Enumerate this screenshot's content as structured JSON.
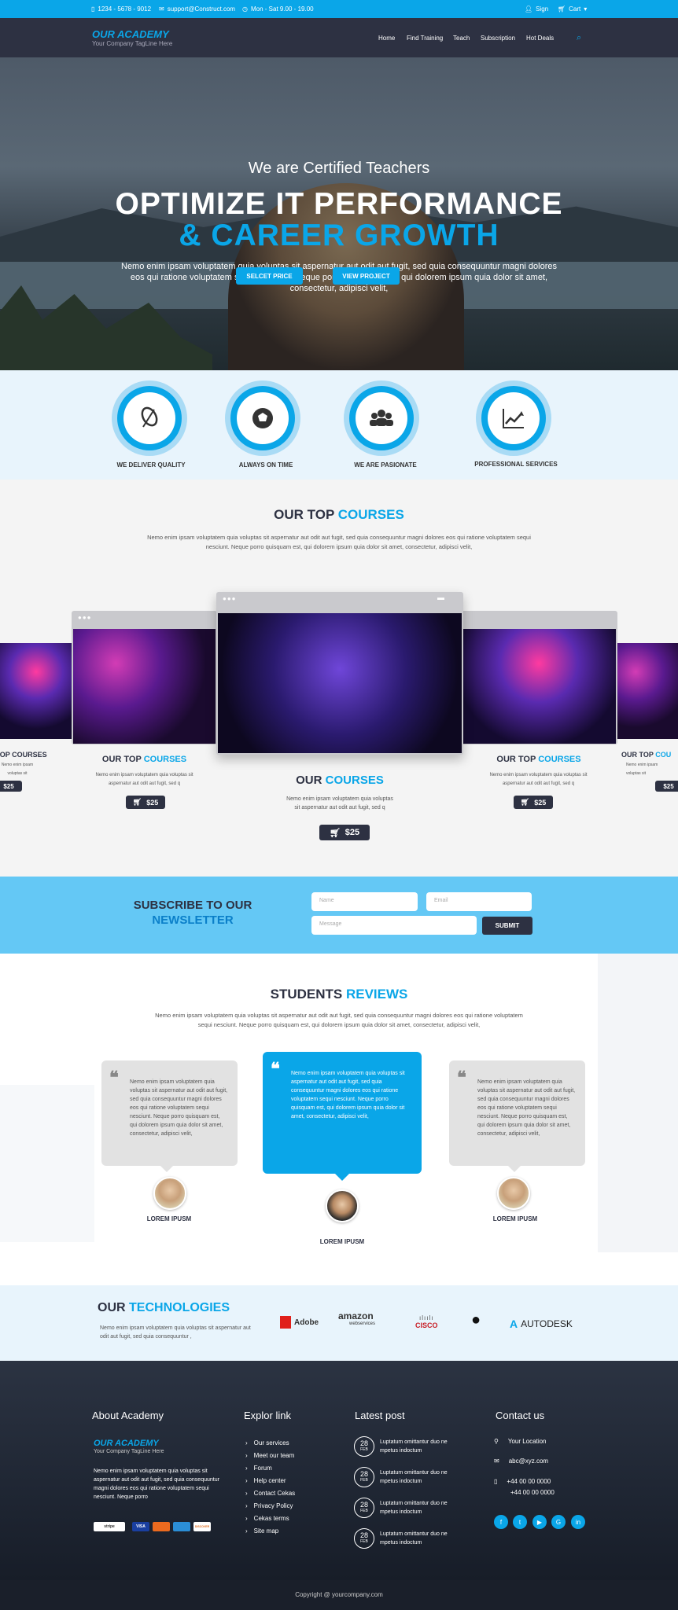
{
  "topbar": {
    "phone": "1234 - 5678 - 9012",
    "email": "support@Construct.com",
    "hours": "Mon - Sat 9.00 - 19.00",
    "sign": "Sign",
    "cart": "Cart"
  },
  "nav": {
    "logo": "OUR ACADEMY",
    "tagline": "Your Company TagLine Here",
    "items": [
      "Home",
      "Find Training",
      "Teach",
      "Subscription",
      "Hot Deals"
    ]
  },
  "hero": {
    "subtitle": "We are Certified Teachers",
    "title1": "OPTIMIZE IT PERFORMANCE",
    "title2": "& CAREER GROWTH",
    "text": "Nemo enim ipsam voluptatem quia voluptas sit aspernatur aut odit aut fugit, sed quia consequuntur magni dolores eos qui ratione voluptatem sequi nesciunt. Neque porro quisquam est, qui dolorem ipsum quia dolor sit amet, consectetur, adipisci velit,",
    "btn1": "SELCET PRICE",
    "btn2": "VIEW PROJECT"
  },
  "features": [
    {
      "label": "WE DELIVER QUALITY",
      "icon": "leaf-icon"
    },
    {
      "label": "ALWAYS ON TIME",
      "icon": "soccer-ball-icon"
    },
    {
      "label": "WE ARE PASIONATE",
      "icon": "group-icon"
    },
    {
      "label": "PROFESSIONAL SERVICES",
      "icon": "chart-icon"
    }
  ],
  "courses": {
    "title_a": "OUR TOP",
    "title_b": "COURSES",
    "text": "Nemo enim ipsam voluptatem quia voluptas sit aspernatur aut odit aut fugit, sed quia consequuntur magni dolores eos qui ratione voluptatem sequi nesciunt. Neque porro quisquam est, qui dolorem ipsum quia dolor sit amet, consectetur, adipisci velit,",
    "left_title_a": "OUR TOP",
    "left_title_b": "COURSES",
    "left_text": "Nemo enim ipsam voluptatem quia voluptas sit aspernatur aut odit aut fugit, sed q",
    "center_title_a": "OUR",
    "center_title_b": "COURSES",
    "center_text": "Nemo enim ipsam voluptatem quia voluptas sit aspernatur aut odit aut fugit, sed q",
    "right_title_a": "OUR TOP",
    "right_title_b": "COURSES",
    "right_text": "Nemo enim ipsam voluptatem quia voluptas sit aspernatur aut odit aut fugit, sed q",
    "edge_left_title": "TOP COURSES",
    "edge_right_title_a": "OUR TOP",
    "edge_right_title_b": "COU",
    "edge_text": "Nemo enim ipsam voluptas sit",
    "price": "$25",
    "edge_price": "$25"
  },
  "newsletter": {
    "title1": "SUBSCRIBE TO OUR",
    "title2": "NEWSLETTER",
    "name_ph": "Name",
    "email_ph": "Email",
    "message_ph": "Message",
    "submit": "SUBMIT"
  },
  "reviews": {
    "title_a": "STUDENTS",
    "title_b": "REVIEWS",
    "text": "Nemo enim ipsam voluptatem quia voluptas sit aspernatur aut odit aut fugit, sed quia consequuntur magni dolores eos qui ratione voluptatem sequi nesciunt. Neque porro quisquam est, qui dolorem ipsum quia dolor sit amet, consectetur, adipisci velit,",
    "items": [
      {
        "text": "Nemo enim ipsam voluptatem quia voluptas sit aspernatur aut odit aut fugit, sed quia consequuntur magni dolores eos qui ratione voluptatem sequi nesciunt. Neque porro quisquam est, qui dolorem ipsum quia dolor sit amet, consectetur, adipisci velit,",
        "name": "LOREM IPUSM"
      },
      {
        "text": "Nemo enim ipsam voluptatem quia voluptas sit aspernatur aut odit aut fugit, sed quia consequuntur magni dolores eos qui ratione voluptatem sequi nesciunt. Neque porro quisquam est, qui dolorem ipsum quia dolor sit amet, consectetur, adipisci velit,",
        "name": "LOREM IPUSM"
      },
      {
        "text": "Nemo enim ipsam voluptatem quia voluptas sit aspernatur aut odit aut fugit, sed quia consequuntur magni dolores eos qui ratione voluptatem sequi nesciunt. Neque porro quisquam est, qui dolorem ipsum quia dolor sit amet, consectetur, adipisci velit,",
        "name": "LOREM IPUSM"
      }
    ]
  },
  "tech": {
    "title_a": "OUR",
    "title_b": "TECHNOLOGIES",
    "text": "Nemo enim ipsam voluptatem quia voluptas sit aspernatur aut odit aut fugit, sed quia consequuntur ,",
    "logos": [
      "Adobe",
      "amazon",
      "webservices",
      "CISCO",
      "AUTODESK"
    ]
  },
  "footer": {
    "about_head": "About Academy",
    "about_logo": "OUR ACADEMY",
    "about_tag": "Your Company TagLine Here",
    "about_text": "Nemo enim ipsam voluptatem quia voluptas sit aspernatur aut odit aut fugit, sed quia consequuntur magni dolores eos qui ratione voluptatem sequi nesciunt. Neque porro",
    "cards": [
      "stripe",
      "VISA",
      "DISCOVER"
    ],
    "links_head": "Explor link",
    "links": [
      "Our services",
      "Meet our team",
      "Forum",
      "Help center",
      "Contact Cekas",
      "Privacy Policy",
      "Cekas terms",
      "Site map"
    ],
    "posts_head": "Latest post",
    "posts": [
      {
        "day": "28",
        "month": "FEB",
        "text": "Luptatum omittantur duo ne mpetus indoctum"
      },
      {
        "day": "28",
        "month": "FEB",
        "text": "Luptatum omittantur duo ne mpetus indoctum"
      },
      {
        "day": "28",
        "month": "FEB",
        "text": "Luptatum omittantur duo ne mpetus indoctum"
      },
      {
        "day": "28",
        "month": "FEB",
        "text": "Luptatum omittantur duo ne mpetus indoctum"
      }
    ],
    "contact_head": "Contact us",
    "location": "Your Location",
    "email": "abc@xyz.com",
    "phone1": "+44 00 00 0000",
    "phone2": "+44 00 00 0000",
    "copyright": "Copyright @ yourcompany.com"
  },
  "colors": {
    "accent": "#0aa6e8",
    "dark": "#2d3142"
  }
}
